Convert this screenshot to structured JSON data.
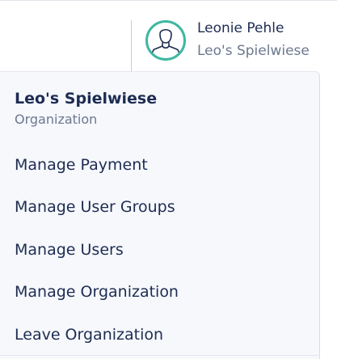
{
  "header": {
    "user_name": "Leonie Pehle",
    "organization": "Leo's Spielwiese",
    "avatar_icon": "user-avatar-icon",
    "avatar_ring_color": "#3fb7a1"
  },
  "dropdown": {
    "org_name": "Leo's Spielwiese",
    "org_subtitle": "Organization",
    "items": [
      {
        "label": "Manage Payment"
      },
      {
        "label": "Manage User Groups"
      },
      {
        "label": "Manage Users"
      },
      {
        "label": "Manage Organization"
      },
      {
        "label": "Leave Organization"
      }
    ]
  }
}
